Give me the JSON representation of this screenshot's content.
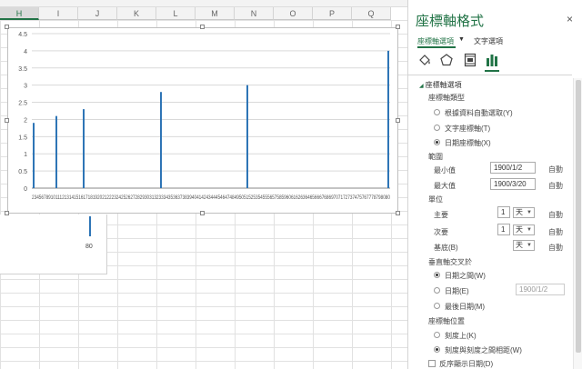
{
  "sheet": {
    "columns": [
      "H",
      "I",
      "J",
      "K",
      "L",
      "M",
      "N",
      "O",
      "P",
      "Q"
    ],
    "selected_column": "H",
    "stray_label": "80"
  },
  "chart_data": {
    "type": "bar",
    "yticks": [
      "4.5",
      "4",
      "3.5",
      "3",
      "2.5",
      "2",
      "1.5",
      "1",
      "0.5",
      "0"
    ],
    "ylim": [
      0,
      4.5
    ],
    "x_tick_text": "23456789101112131415161718192021222324252627282930313233343536373839404142434445464748495051525354555657585960616263646566676869707172737475767778798080",
    "bars": [
      {
        "x": 2,
        "value": 1.9
      },
      {
        "x": 7,
        "value": 2.1
      },
      {
        "x": 13,
        "value": 2.3
      },
      {
        "x": 30,
        "value": 2.8
      },
      {
        "x": 49,
        "value": 3.0
      },
      {
        "x": 80,
        "value": 4.0
      }
    ],
    "xlim": [
      2,
      80
    ],
    "bar_color": "#2e75b6"
  },
  "pane": {
    "title": "座標軸格式",
    "close": "×",
    "tab_axis": "座標軸選項",
    "tab_chevron": "▼",
    "tab_text": "文字選項",
    "section_axis_options": "座標軸選項",
    "axis_type_label": "座標軸類型",
    "axis_type_options": [
      "根據資料自動選取(Y)",
      "文字座標軸(T)",
      "日期座標軸(X)"
    ],
    "axis_type_selected": 2,
    "bounds_label": "範圍",
    "min_label": "最小值",
    "min_value": "1900/1/2",
    "max_label": "最大值",
    "max_value": "1900/3/20",
    "auto": "自動",
    "units_label": "單位",
    "major_label": "主要",
    "major_value": "1",
    "major_unit": "天",
    "minor_label": "次要",
    "minor_value": "1",
    "minor_unit": "天",
    "base_label": "基底(B)",
    "base_unit": "天",
    "cross_label": "垂直軸交叉於",
    "cross_options": [
      "日期之間(W)",
      "日期(E)",
      "最後日期(M)"
    ],
    "cross_selected": 0,
    "cross_date_value": "1900/1/2",
    "position_label": "座標軸位置",
    "position_options": [
      "刻度上(K)",
      "刻度與刻度之間相距(W)"
    ],
    "position_selected": 1,
    "reverse_label": "反序顯示日期(D)"
  },
  "colors": {
    "accent": "#217346",
    "bar": "#2e75b6"
  }
}
